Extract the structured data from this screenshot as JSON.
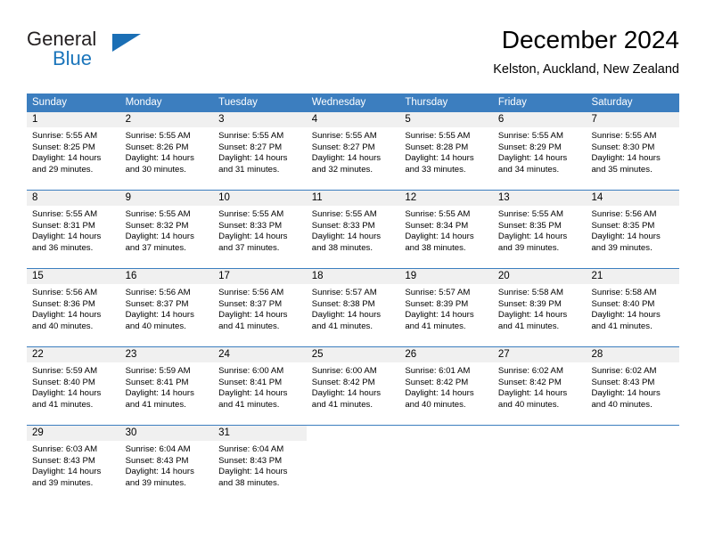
{
  "brand": {
    "name_part1": "General",
    "name_part2": "Blue",
    "triangle_icon": "triangle-icon",
    "accent_color": "#1b75bb"
  },
  "header": {
    "title": "December 2024",
    "location": "Kelston, Auckland, New Zealand"
  },
  "calendar": {
    "header_bg_color": "#3c7ebf",
    "day_band_color": "#f0f0f0",
    "weekday_headers": [
      "Sunday",
      "Monday",
      "Tuesday",
      "Wednesday",
      "Thursday",
      "Friday",
      "Saturday"
    ],
    "weeks": [
      [
        {
          "day": "1",
          "sunrise": "Sunrise: 5:55 AM",
          "sunset": "Sunset: 8:25 PM",
          "daylight": "Daylight: 14 hours and 29 minutes."
        },
        {
          "day": "2",
          "sunrise": "Sunrise: 5:55 AM",
          "sunset": "Sunset: 8:26 PM",
          "daylight": "Daylight: 14 hours and 30 minutes."
        },
        {
          "day": "3",
          "sunrise": "Sunrise: 5:55 AM",
          "sunset": "Sunset: 8:27 PM",
          "daylight": "Daylight: 14 hours and 31 minutes."
        },
        {
          "day": "4",
          "sunrise": "Sunrise: 5:55 AM",
          "sunset": "Sunset: 8:27 PM",
          "daylight": "Daylight: 14 hours and 32 minutes."
        },
        {
          "day": "5",
          "sunrise": "Sunrise: 5:55 AM",
          "sunset": "Sunset: 8:28 PM",
          "daylight": "Daylight: 14 hours and 33 minutes."
        },
        {
          "day": "6",
          "sunrise": "Sunrise: 5:55 AM",
          "sunset": "Sunset: 8:29 PM",
          "daylight": "Daylight: 14 hours and 34 minutes."
        },
        {
          "day": "7",
          "sunrise": "Sunrise: 5:55 AM",
          "sunset": "Sunset: 8:30 PM",
          "daylight": "Daylight: 14 hours and 35 minutes."
        }
      ],
      [
        {
          "day": "8",
          "sunrise": "Sunrise: 5:55 AM",
          "sunset": "Sunset: 8:31 PM",
          "daylight": "Daylight: 14 hours and 36 minutes."
        },
        {
          "day": "9",
          "sunrise": "Sunrise: 5:55 AM",
          "sunset": "Sunset: 8:32 PM",
          "daylight": "Daylight: 14 hours and 37 minutes."
        },
        {
          "day": "10",
          "sunrise": "Sunrise: 5:55 AM",
          "sunset": "Sunset: 8:33 PM",
          "daylight": "Daylight: 14 hours and 37 minutes."
        },
        {
          "day": "11",
          "sunrise": "Sunrise: 5:55 AM",
          "sunset": "Sunset: 8:33 PM",
          "daylight": "Daylight: 14 hours and 38 minutes."
        },
        {
          "day": "12",
          "sunrise": "Sunrise: 5:55 AM",
          "sunset": "Sunset: 8:34 PM",
          "daylight": "Daylight: 14 hours and 38 minutes."
        },
        {
          "day": "13",
          "sunrise": "Sunrise: 5:55 AM",
          "sunset": "Sunset: 8:35 PM",
          "daylight": "Daylight: 14 hours and 39 minutes."
        },
        {
          "day": "14",
          "sunrise": "Sunrise: 5:56 AM",
          "sunset": "Sunset: 8:35 PM",
          "daylight": "Daylight: 14 hours and 39 minutes."
        }
      ],
      [
        {
          "day": "15",
          "sunrise": "Sunrise: 5:56 AM",
          "sunset": "Sunset: 8:36 PM",
          "daylight": "Daylight: 14 hours and 40 minutes."
        },
        {
          "day": "16",
          "sunrise": "Sunrise: 5:56 AM",
          "sunset": "Sunset: 8:37 PM",
          "daylight": "Daylight: 14 hours and 40 minutes."
        },
        {
          "day": "17",
          "sunrise": "Sunrise: 5:56 AM",
          "sunset": "Sunset: 8:37 PM",
          "daylight": "Daylight: 14 hours and 41 minutes."
        },
        {
          "day": "18",
          "sunrise": "Sunrise: 5:57 AM",
          "sunset": "Sunset: 8:38 PM",
          "daylight": "Daylight: 14 hours and 41 minutes."
        },
        {
          "day": "19",
          "sunrise": "Sunrise: 5:57 AM",
          "sunset": "Sunset: 8:39 PM",
          "daylight": "Daylight: 14 hours and 41 minutes."
        },
        {
          "day": "20",
          "sunrise": "Sunrise: 5:58 AM",
          "sunset": "Sunset: 8:39 PM",
          "daylight": "Daylight: 14 hours and 41 minutes."
        },
        {
          "day": "21",
          "sunrise": "Sunrise: 5:58 AM",
          "sunset": "Sunset: 8:40 PM",
          "daylight": "Daylight: 14 hours and 41 minutes."
        }
      ],
      [
        {
          "day": "22",
          "sunrise": "Sunrise: 5:59 AM",
          "sunset": "Sunset: 8:40 PM",
          "daylight": "Daylight: 14 hours and 41 minutes."
        },
        {
          "day": "23",
          "sunrise": "Sunrise: 5:59 AM",
          "sunset": "Sunset: 8:41 PM",
          "daylight": "Daylight: 14 hours and 41 minutes."
        },
        {
          "day": "24",
          "sunrise": "Sunrise: 6:00 AM",
          "sunset": "Sunset: 8:41 PM",
          "daylight": "Daylight: 14 hours and 41 minutes."
        },
        {
          "day": "25",
          "sunrise": "Sunrise: 6:00 AM",
          "sunset": "Sunset: 8:42 PM",
          "daylight": "Daylight: 14 hours and 41 minutes."
        },
        {
          "day": "26",
          "sunrise": "Sunrise: 6:01 AM",
          "sunset": "Sunset: 8:42 PM",
          "daylight": "Daylight: 14 hours and 40 minutes."
        },
        {
          "day": "27",
          "sunrise": "Sunrise: 6:02 AM",
          "sunset": "Sunset: 8:42 PM",
          "daylight": "Daylight: 14 hours and 40 minutes."
        },
        {
          "day": "28",
          "sunrise": "Sunrise: 6:02 AM",
          "sunset": "Sunset: 8:43 PM",
          "daylight": "Daylight: 14 hours and 40 minutes."
        }
      ],
      [
        {
          "day": "29",
          "sunrise": "Sunrise: 6:03 AM",
          "sunset": "Sunset: 8:43 PM",
          "daylight": "Daylight: 14 hours and 39 minutes."
        },
        {
          "day": "30",
          "sunrise": "Sunrise: 6:04 AM",
          "sunset": "Sunset: 8:43 PM",
          "daylight": "Daylight: 14 hours and 39 minutes."
        },
        {
          "day": "31",
          "sunrise": "Sunrise: 6:04 AM",
          "sunset": "Sunset: 8:43 PM",
          "daylight": "Daylight: 14 hours and 38 minutes."
        },
        {
          "day": "",
          "sunrise": "",
          "sunset": "",
          "daylight": ""
        },
        {
          "day": "",
          "sunrise": "",
          "sunset": "",
          "daylight": ""
        },
        {
          "day": "",
          "sunrise": "",
          "sunset": "",
          "daylight": ""
        },
        {
          "day": "",
          "sunrise": "",
          "sunset": "",
          "daylight": ""
        }
      ]
    ]
  }
}
